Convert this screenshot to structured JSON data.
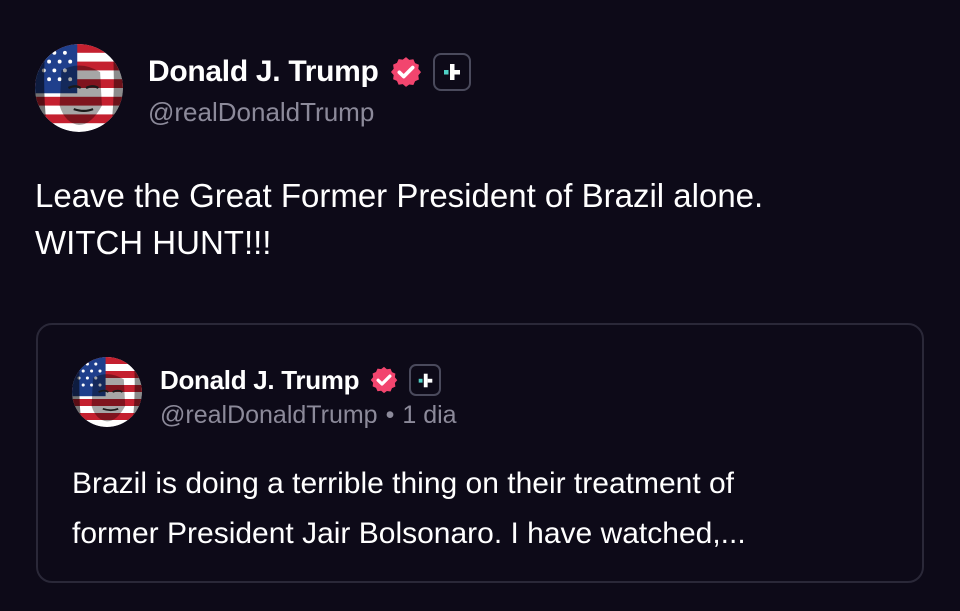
{
  "post": {
    "author": {
      "display_name": "Donald J. Trump",
      "handle": "@realDonaldTrump",
      "avatar_icon": "flag-face-avatar",
      "verified_icon": "verified-badge-icon",
      "plus_icon": "plus-badge-icon"
    },
    "text_lines": [
      "Leave the Great Former President of Brazil alone.",
      "WITCH HUNT!!!"
    ]
  },
  "quote": {
    "author": {
      "display_name": "Donald J. Trump",
      "handle": "@realDonaldTrump",
      "separator": "•",
      "timestamp": "1 dia",
      "avatar_icon": "flag-face-avatar",
      "verified_icon": "verified-badge-icon",
      "plus_icon": "plus-badge-icon"
    },
    "text_lines": [
      "Brazil is doing a terrible thing on their treatment of",
      "former President Jair Bolsonaro. I have watched,..."
    ]
  },
  "colors": {
    "background": "#0d0a18",
    "verified_badge": "#f2456e",
    "plus_teal": "#4fd1c5",
    "muted_text": "#8c8a9a",
    "card_border": "#2a2838"
  }
}
